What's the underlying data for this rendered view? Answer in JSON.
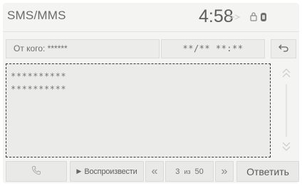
{
  "header": {
    "app_title": "SMS/MMS",
    "clock": "4:58",
    "status_icons": [
      "signal-icon",
      "bluetooth-icon",
      "battery-icon"
    ]
  },
  "info": {
    "from_label": "От кого: ******",
    "date_time": "**/** **:**"
  },
  "message": {
    "lines": [
      "**********",
      "**********"
    ]
  },
  "bottom": {
    "play_label": "Воспроизвести",
    "prev_label": "«",
    "next_label": "»",
    "page_current": "3",
    "page_of": "из",
    "page_total": "50",
    "reply_label": "Ответить"
  }
}
